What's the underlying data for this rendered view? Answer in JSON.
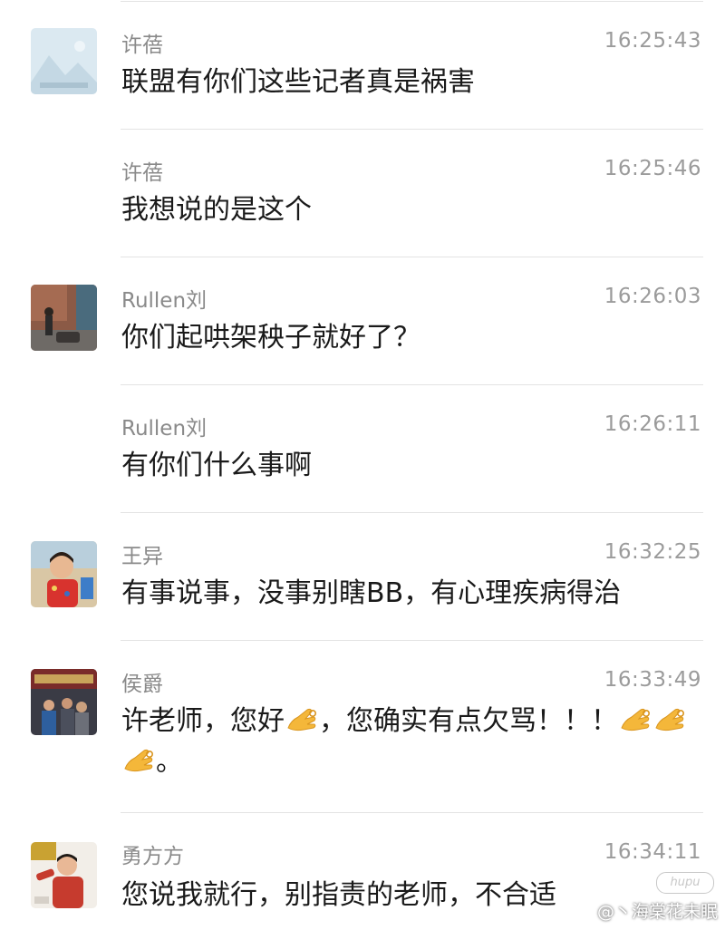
{
  "messages": [
    {
      "sender": "许蓓",
      "time": "16:25:43",
      "text": "联盟有你们这些记者真是祸害",
      "avatar": "placeholder-image"
    },
    {
      "sender": "许蓓",
      "time": "16:25:46",
      "text": "我想说的是这个",
      "avatar": ""
    },
    {
      "sender": "Rullen刘",
      "time": "16:26:03",
      "text": "你们起哄架秧子就好了？",
      "avatar": "photo-outdoor-street"
    },
    {
      "sender": "Rullen刘",
      "time": "16:26:11",
      "text": "有你们什么事啊",
      "avatar": ""
    },
    {
      "sender": "王异",
      "time": "16:32:25",
      "text": "有事说事，没事别瞎BB，有心理疾病得治",
      "avatar": "photo-child"
    },
    {
      "sender": "侯爵",
      "time": "16:33:49",
      "text_parts": [
        "许老师，您好",
        "，您确实有点欠骂！！！",
        "。"
      ],
      "emoji": "ok-hand-emoji",
      "avatar": "photo-event"
    },
    {
      "sender": "勇方方",
      "time": "16:34:11",
      "text": "您说我就行，别指责的老师，不合适",
      "avatar": "photo-person-red"
    }
  ],
  "watermark": {
    "text": "@丶海棠花未眠",
    "logo": "hupu"
  },
  "colors": {
    "sender": "#8a8a8a",
    "time": "#9b9b9b",
    "text": "#1a1a1a",
    "divider": "#e3e3e3"
  }
}
